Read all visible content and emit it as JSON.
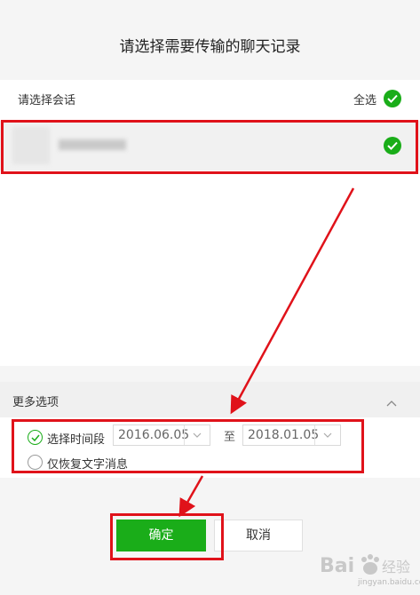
{
  "dialog": {
    "title": "请选择需要传输的聊天记录"
  },
  "session_list": {
    "header": "请选择会话",
    "select_all_label": "全选"
  },
  "more_options": {
    "label": "更多选项",
    "time_range_label": "选择时间段",
    "start_date": "2016.06.05",
    "to_label": "至",
    "end_date": "2018.01.05",
    "text_only_label": "仅恢复文字消息"
  },
  "buttons": {
    "confirm": "确定",
    "cancel": "取消"
  },
  "watermark": {
    "site": "jingyan.baidu.com"
  },
  "colors": {
    "accent_green": "#1aad19",
    "annotation_red": "#e0121a"
  }
}
